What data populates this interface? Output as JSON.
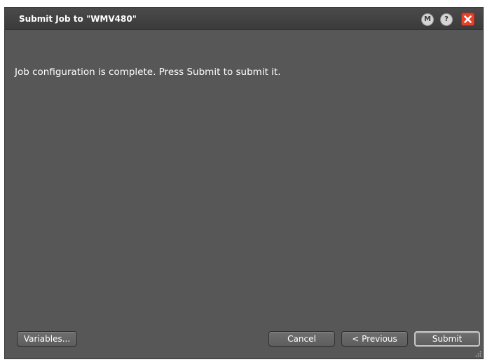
{
  "dialog": {
    "title": "Submit Job to \"WMV480\"",
    "titlebar_buttons": {
      "m_label": "M",
      "help_label": "?",
      "close_icon": "close-icon"
    },
    "message": "Job configuration is complete.  Press Submit to submit it."
  },
  "buttons": {
    "variables": "Variables...",
    "cancel": "Cancel",
    "previous": "< Previous",
    "submit": "Submit"
  },
  "colors": {
    "dialog_bg": "#575757",
    "titlebar_bg": "#3e3e3e",
    "close_red": "#e8402a"
  }
}
